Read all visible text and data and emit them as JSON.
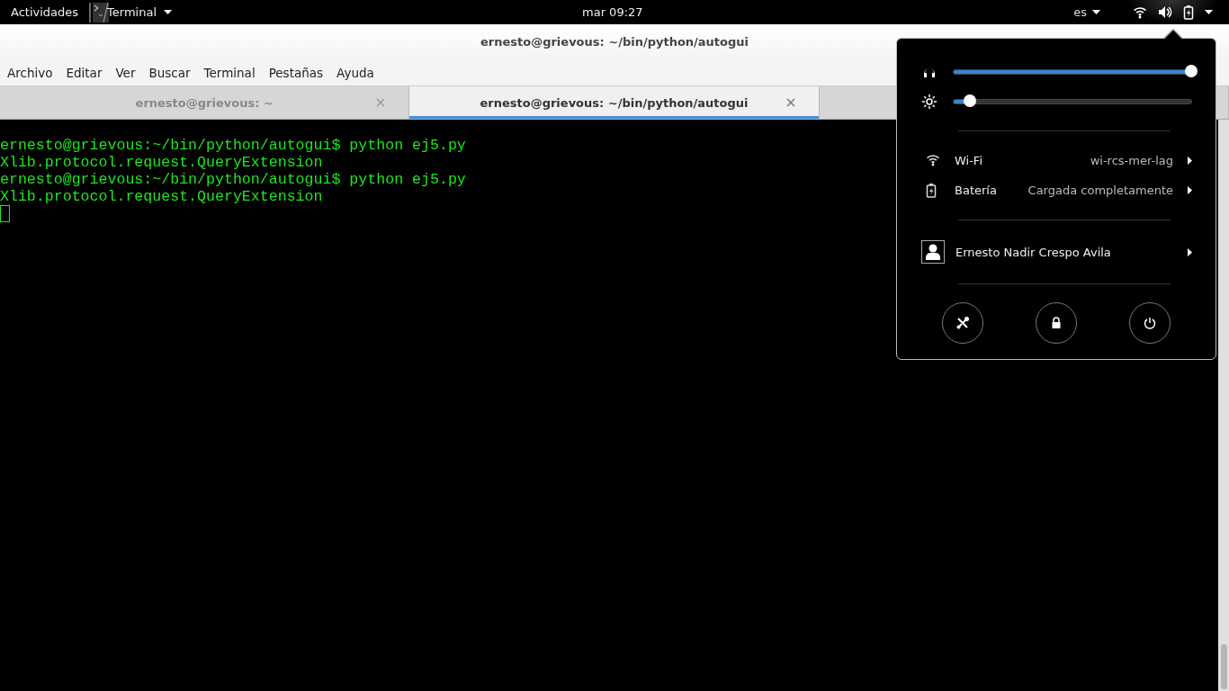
{
  "top_bar": {
    "activities": "Actividades",
    "app_menu": {
      "label": "Terminal"
    },
    "clock": "mar 09:27",
    "input_source": "es"
  },
  "window": {
    "title": "ernesto@grievous: ~/bin/python/autogui",
    "menu": [
      "Archivo",
      "Editar",
      "Ver",
      "Buscar",
      "Terminal",
      "Pestañas",
      "Ayuda"
    ],
    "tabs": [
      {
        "label": "ernesto@grievous: ~",
        "selected": false
      },
      {
        "label": "ernesto@grievous: ~/bin/python/autogui",
        "selected": true
      },
      {
        "selected": false
      }
    ],
    "terminal": {
      "lines": [
        "ernesto@grievous:~/bin/python/autogui$ python ej5.py",
        "Xlib.protocol.request.QueryExtension",
        "ernesto@grievous:~/bin/python/autogui$ python ej5.py",
        "Xlib.protocol.request.QueryExtension"
      ]
    }
  },
  "system_menu": {
    "sliders": [
      {
        "kind": "volume",
        "level": 1.0
      },
      {
        "kind": "brightness",
        "level": 0.07
      }
    ],
    "rows": [
      {
        "kind": "wifi",
        "label": "Wi-Fi",
        "value": "wi-rcs-mer-lag"
      },
      {
        "kind": "battery",
        "label": "Batería",
        "value": "Cargada completamente"
      }
    ],
    "user": {
      "name": "Ernesto Nadir Crespo Avila"
    },
    "actions": [
      {
        "kind": "settings"
      },
      {
        "kind": "lock"
      },
      {
        "kind": "power"
      }
    ]
  }
}
